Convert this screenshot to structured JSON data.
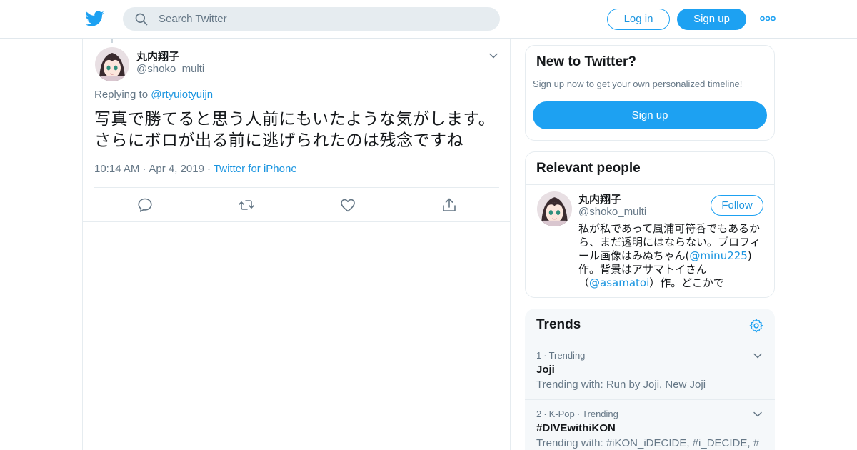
{
  "header": {
    "logo_icon": "twitter-bird-icon",
    "search_placeholder": "Search Twitter",
    "login_label": "Log in",
    "signup_label": "Sign up",
    "more_icon": "more-dots-icon",
    "brand_color": "#1da1f2"
  },
  "tweet": {
    "name": "丸内翔子",
    "handle": "@shoko_multi",
    "replying_prefix": "Replying to",
    "replying_to": "@rtyuiotyuijn",
    "text_line1": "写真で勝てると思う人前にもいたような気がします。",
    "text_line2": "さらにボロが出る前に逃げられたのは残念ですね",
    "time": "10:14 AM",
    "date": "Apr 4, 2019",
    "source": "Twitter for iPhone",
    "actions": [
      "reply-icon",
      "retweet-icon",
      "like-icon",
      "share-icon"
    ]
  },
  "sidebar": {
    "new_to_twitter": {
      "title": "New to Twitter?",
      "subtitle": "Sign up now to get your own personalized timeline!",
      "button": "Sign up"
    },
    "relevant_people": {
      "title": "Relevant people",
      "name": "丸内翔子",
      "handle": "@shoko_multi",
      "follow_label": "Follow",
      "bio_part1": "私が私であって風浦可符香でもあるから、まだ透明にはならない。プロフィール画像はみぬちゃん(",
      "bio_link1": "@minu225",
      "bio_part2": ")作。背景はアサマトイさん（",
      "bio_link2": "@asamatoi",
      "bio_part3": "）作。どこかで"
    },
    "trends": {
      "title": "Trends",
      "items": [
        {
          "rank": "1",
          "category": "Trending",
          "name": "Joji",
          "with": "Trending with: Run by Joji, New Joji"
        },
        {
          "rank": "2",
          "category": "K-Pop",
          "category2": "Trending",
          "name": "#DIVEwithiKON",
          "with": "Trending with: #iKON_iDECIDE, #i_DECIDE, #"
        }
      ]
    }
  }
}
